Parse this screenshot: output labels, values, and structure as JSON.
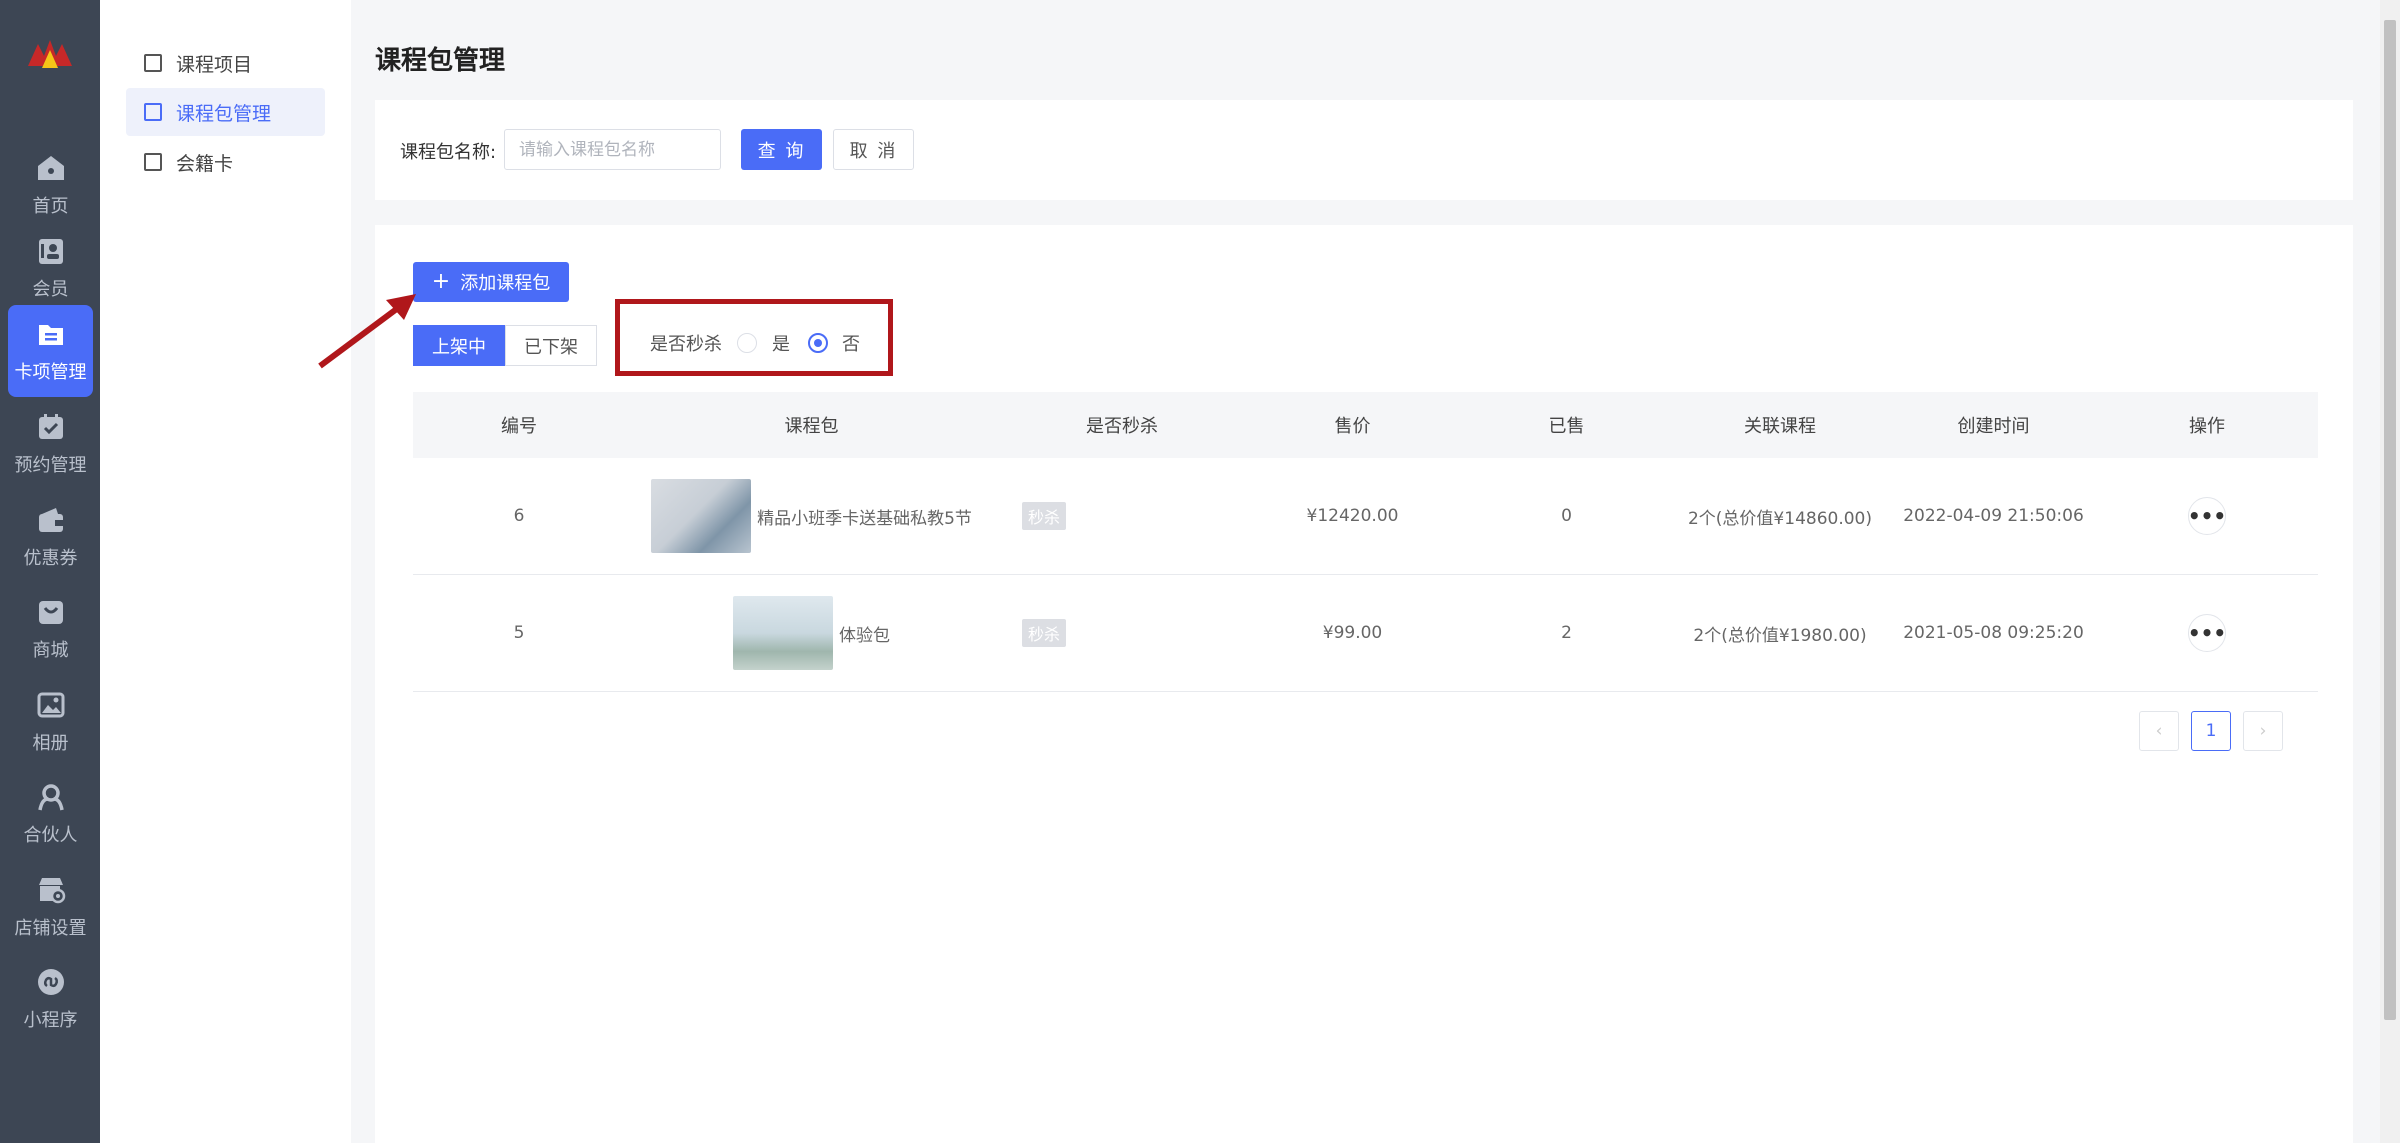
{
  "nav": {
    "items": [
      {
        "label": "首页",
        "icon": "home-icon"
      },
      {
        "label": "会员",
        "icon": "member-card-icon"
      },
      {
        "label": "卡项管理",
        "icon": "folder-icon"
      },
      {
        "label": "预约管理",
        "icon": "calendar-check-icon"
      },
      {
        "label": "优惠券",
        "icon": "wallet-icon"
      },
      {
        "label": "商城",
        "icon": "shopping-bag-icon"
      },
      {
        "label": "相册",
        "icon": "image-icon"
      },
      {
        "label": "合伙人",
        "icon": "partner-icon"
      },
      {
        "label": "店铺设置",
        "icon": "store-settings-icon"
      },
      {
        "label": "小程序",
        "icon": "mini-program-icon"
      }
    ],
    "active_index": 2,
    "accent": "#4a6cf7"
  },
  "submenu": {
    "items": [
      {
        "label": "课程项目"
      },
      {
        "label": "课程包管理"
      },
      {
        "label": "会籍卡"
      }
    ],
    "active_index": 1
  },
  "page": {
    "title": "课程包管理"
  },
  "search": {
    "label": "课程包名称:",
    "placeholder": "请输入课程包名称",
    "value": "",
    "query_label": "查 询",
    "cancel_label": "取 消"
  },
  "toolbar": {
    "add_label": "添加课程包"
  },
  "status_tabs": {
    "on_shelf": "上架中",
    "off_shelf": "已下架",
    "active": "on_shelf"
  },
  "flash_filter": {
    "label": "是否秒杀",
    "yes": "是",
    "no": "否",
    "selected": "no"
  },
  "table": {
    "headers": [
      "编号",
      "课程包",
      "是否秒杀",
      "售价",
      "已售",
      "关联课程",
      "创建时间",
      "操作"
    ],
    "rows": [
      {
        "id": "6",
        "name": "精品小班季卡送基础私教5节",
        "flash": "秒杀",
        "price": "¥12420.00",
        "sold": "0",
        "courses": "2个(总价值¥14860.00)",
        "created": "2022-04-09 21:50:06"
      },
      {
        "id": "5",
        "name": "体验包",
        "flash": "秒杀",
        "price": "¥99.00",
        "sold": "2",
        "courses": "2个(总价值¥1980.00)",
        "created": "2021-05-08 09:25:20"
      }
    ]
  },
  "pagination": {
    "prev": "‹",
    "current": "1",
    "next": "›"
  },
  "annotation_color": "#b0171b"
}
